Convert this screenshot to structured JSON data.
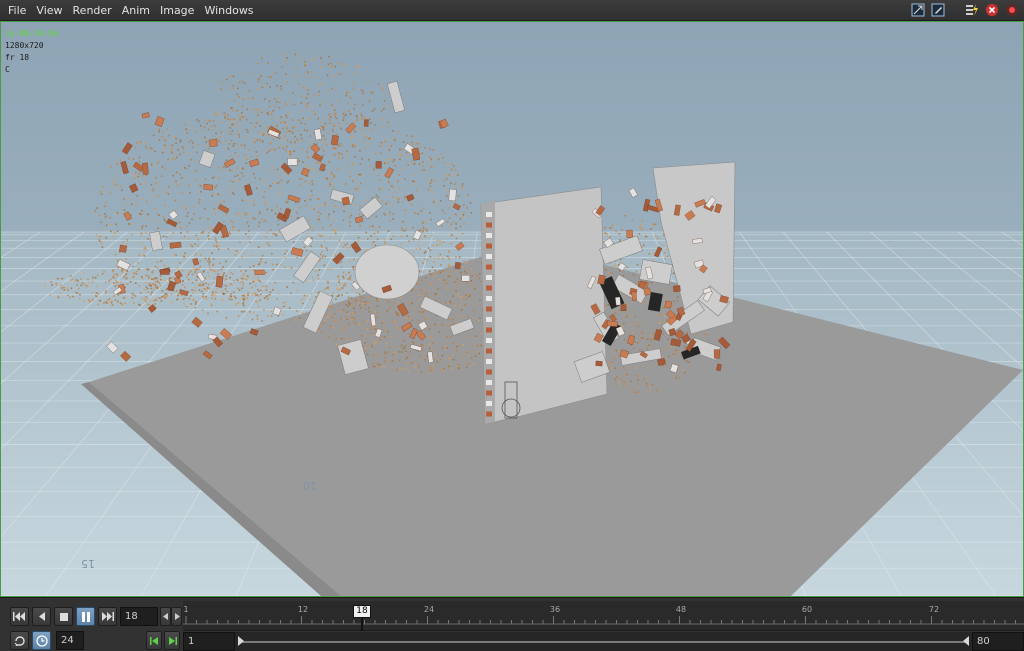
{
  "menu": {
    "items": [
      "File",
      "View",
      "Render",
      "Anim",
      "Image",
      "Windows"
    ]
  },
  "toolbar_icons": [
    "fit-view-icon",
    "edit-view-icon",
    "lightning-icon",
    "close-icon",
    "record-icon"
  ],
  "viewport": {
    "hud": {
      "name": "ip-08:34:56",
      "resolution": "1280x720",
      "frame": "fr 18",
      "channel": "C"
    },
    "grid_labels": [
      "10",
      "15"
    ],
    "colors": {
      "sky": "#8ea4b4",
      "grid_floor": "#c8d8de",
      "ground": "#9a9a9a",
      "wall": "#c2c2c2",
      "brick": "#b56a44",
      "dust": "#c58d52"
    }
  },
  "playbar": {
    "current_frame": "18",
    "fps": "24",
    "range_start": "1",
    "range_end": "80",
    "ruler_ticks": [
      "1",
      "12",
      "24",
      "36",
      "48",
      "60",
      "72"
    ],
    "cursor_label": "18"
  }
}
